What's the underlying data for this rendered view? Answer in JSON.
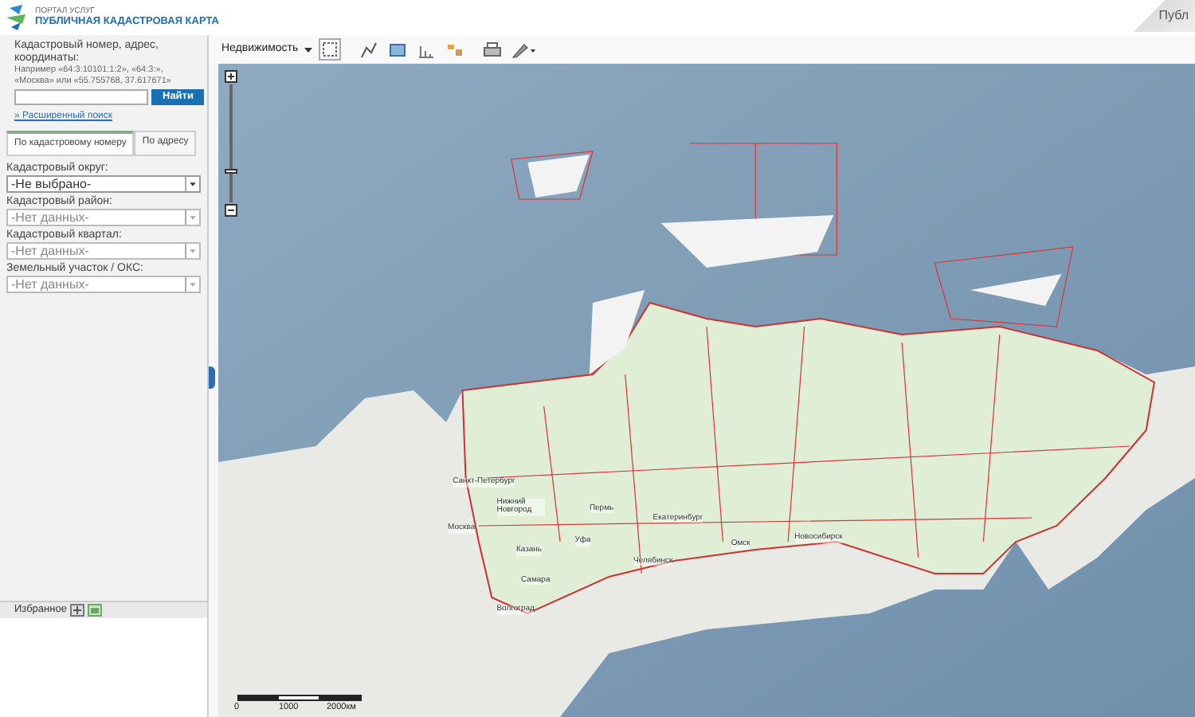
{
  "header": {
    "portal": "ПОРТАЛ УСЛУГ",
    "title": "ПУБЛИЧНАЯ КАДАСТРОВАЯ КАРТА",
    "corner_tab": "Публ"
  },
  "search": {
    "label": "Кадастровый номер, адрес, координаты:",
    "hint_lines": [
      "Например «64:3:10101:1:2», «64:3:»,",
      "«Москва» или «55.755768, 37.617671»"
    ],
    "button": "Найти",
    "advanced_link": "» Расширенный поиск"
  },
  "tabs": [
    {
      "label": "По кадастровому номеру",
      "selected": true
    },
    {
      "label": "По адресу",
      "selected": false
    }
  ],
  "fields": [
    {
      "label": "Кадастровый округ:",
      "value": "-Не выбрано-",
      "disabled": false
    },
    {
      "label": "Кадастровый район:",
      "value": "-Нет данных-",
      "disabled": true
    },
    {
      "label": "Кадастровый квартал:",
      "value": "-Нет данных-",
      "disabled": true
    },
    {
      "label": "Земельный участок / ОКС:",
      "value": "-Нет данных-",
      "disabled": true
    }
  ],
  "favorites": {
    "title": "Избранное"
  },
  "toolbar": {
    "layer_select": "Недвижимость"
  },
  "map": {
    "zoom": {
      "level": 0.25
    },
    "cities": [
      "Санкт-Петербург",
      "Нижний Новгород",
      "Пермь",
      "Москва",
      "Екатеринбург",
      "Омск",
      "Новосибирск",
      "Уфа",
      "Казань",
      "Челябинск",
      "Самара",
      "Волгоград"
    ],
    "scale": [
      "0",
      "1000",
      "2000км"
    ]
  }
}
